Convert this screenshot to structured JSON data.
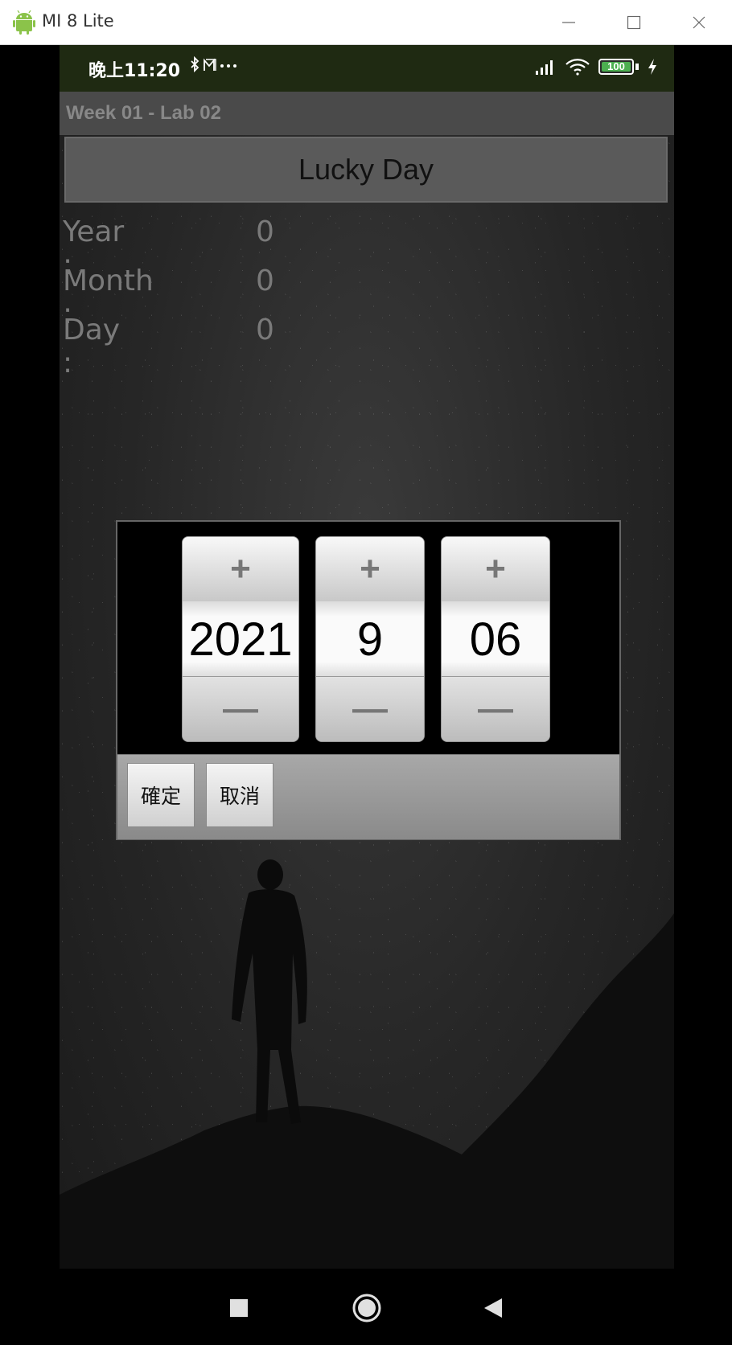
{
  "window": {
    "title": "MI 8 Lite",
    "icon": "android-icon",
    "controls": [
      "minimize-icon",
      "maximize-icon",
      "close-icon"
    ]
  },
  "status_bar": {
    "time": "晚上11:20",
    "extra": "✱ M ···",
    "battery": "100"
  },
  "app": {
    "title": "Week 01 - Lab 02",
    "lucky_button": "Lucky Day",
    "fields": [
      {
        "label": "Year :",
        "value": "0"
      },
      {
        "label": "Month :",
        "value": "0"
      },
      {
        "label": "Day :",
        "value": "0"
      }
    ]
  },
  "date_picker": {
    "columns": [
      {
        "name": "year",
        "value": "2021",
        "plus": "+",
        "minus": "—"
      },
      {
        "name": "month",
        "value": "9",
        "plus": "+",
        "minus": "—"
      },
      {
        "name": "day",
        "value": "06",
        "plus": "+",
        "minus": "—"
      }
    ],
    "confirm_label": "確定",
    "cancel_label": "取消"
  },
  "nav_bar": {
    "icons": [
      "recents-square-icon",
      "home-circle-icon",
      "back-triangle-icon"
    ]
  },
  "colors": {
    "status_bar_bg": "#1f2a12",
    "battery_green": "#4caf50"
  }
}
